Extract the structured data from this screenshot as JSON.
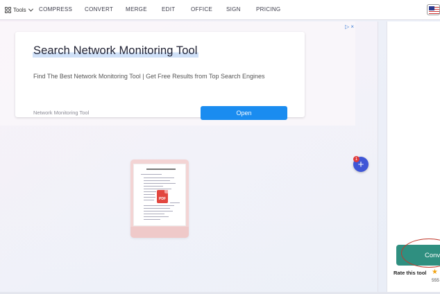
{
  "topnav": {
    "tools_label": "Tools",
    "items": [
      "COMPRESS",
      "CONVERT",
      "MERGE",
      "EDIT",
      "OFFICE",
      "SIGN",
      "PRICING"
    ]
  },
  "ad": {
    "title": "Search Network Monitoring Tool",
    "description": "Find The Best Network Monitoring Tool | Get Free Results from Top Search Engines",
    "source": "Network Monitoring Tool",
    "open_label": "Open",
    "close_glyph": "▷ ×"
  },
  "file": {
    "badge": "PDF"
  },
  "add_files": {
    "count": "1",
    "glyph": "+"
  },
  "sidebar": {
    "convert_label": "Convert",
    "rate_label": "Rate this tool",
    "rating_count": "555"
  },
  "colors": {
    "accent_blue": "#1a8cf0",
    "add_button": "#3f56d6",
    "convert_green": "#2f8f80",
    "annotation_red": "#c0392b",
    "star": "#f2a30f"
  }
}
